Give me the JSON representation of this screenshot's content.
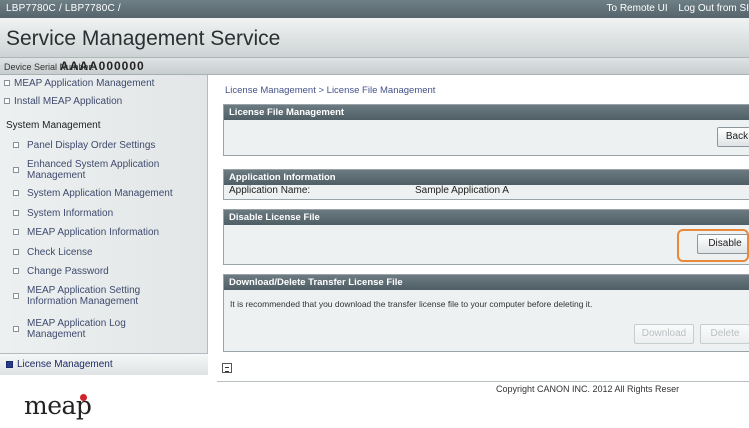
{
  "topbar": {
    "path": "LBP7780C / LBP7780C /",
    "remote_ui_link": "To Remote UI",
    "logout_link": "Log Out from SI"
  },
  "header": {
    "title": "Service Management Service"
  },
  "serial": {
    "label": "Device Serial Number:",
    "value": "AAAA000000"
  },
  "sidebar": {
    "top_items": [
      "MEAP Application Management",
      "Install MEAP Application"
    ],
    "section_heading": "System Management",
    "sub_items": [
      "Panel Display Order Settings",
      "Enhanced System Application Management",
      "System Application Management",
      "System Information",
      "MEAP Application Information",
      "Check License",
      "Change Password",
      "MEAP Application Setting Information Management",
      "MEAP Application Log Management"
    ],
    "active_item": "License Management"
  },
  "main": {
    "breadcrumb": "License Management > License File Management",
    "license_panel": {
      "title": "License File Management",
      "back_button": "Back"
    },
    "app_info_panel": {
      "title": "Application Information",
      "name_label": "Application Name:",
      "name_value": "Sample Application A"
    },
    "disable_panel": {
      "title": "Disable License File",
      "disable_button": "Disable"
    },
    "transfer_panel": {
      "title": "Download/Delete Transfer License File",
      "note": "It is recommended that you download the transfer license file to your computer before deleting it.",
      "download_button": "Download",
      "delete_button": "Delete"
    }
  },
  "footer": {
    "logo_text": "meap",
    "copyright": "Copyright CANON INC. 2012 All Rights Reser"
  },
  "colors": {
    "highlight": "#e8883a",
    "panel_header": "#56656c",
    "link": "#3f4b6e"
  }
}
